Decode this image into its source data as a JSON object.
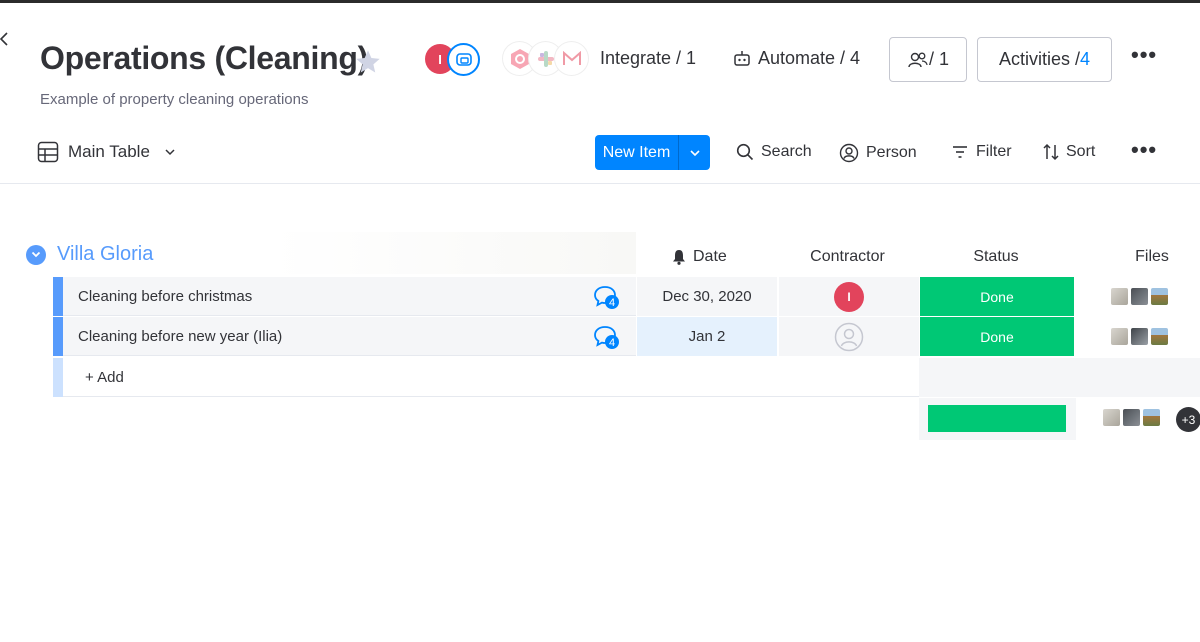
{
  "board": {
    "title": "Operations (Cleaning)",
    "description": "Example of property cleaning operations",
    "owner_initial": "I"
  },
  "toolbar": {
    "integrate_label": "Integrate / 1",
    "automate_label": "Automate / 4",
    "members_label": "/ 1",
    "activities_label": "Activities / ",
    "activities_count": "4"
  },
  "view": {
    "main_table_label": "Main Table",
    "new_item_label": "New Item",
    "search_label": "Search",
    "person_label": "Person",
    "filter_label": "Filter",
    "sort_label": "Sort"
  },
  "group": {
    "title": "Villa Gloria",
    "color": "#579bfc",
    "columns": [
      "Date",
      "Contractor",
      "Status",
      "Files"
    ],
    "items": [
      {
        "name": "Cleaning before christmas",
        "updates": "4",
        "date": "Dec 30, 2020",
        "contractor_initial": "I",
        "status": "Done"
      },
      {
        "name": "Cleaning before new year (Ilia)",
        "updates": "4",
        "date": "Jan 2",
        "contractor_initial": "",
        "status": "Done"
      }
    ],
    "add_label": "+ Add",
    "summary_files_more": "+3"
  },
  "colors": {
    "primary": "#0085ff",
    "done": "#00c875",
    "avatar_red": "#e2445c"
  }
}
